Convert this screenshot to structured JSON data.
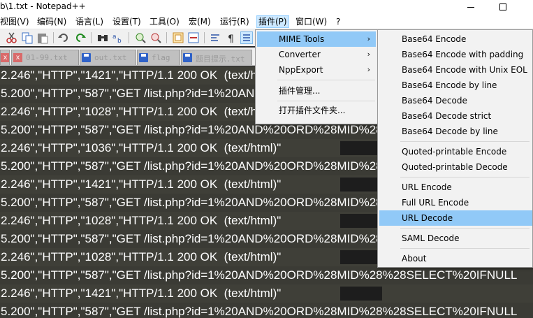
{
  "window": {
    "title": "b\\1.txt - Notepad++"
  },
  "menubar": {
    "items": [
      "视图(V)",
      "编码(N)",
      "语言(L)",
      "设置(T)",
      "工具(O)",
      "宏(M)",
      "运行(R)",
      "插件(P)",
      "窗口(W)",
      "?"
    ],
    "active_index": 7
  },
  "tabs": [
    "01-99.txt",
    "out.txt",
    "flag",
    "题目提示.txt"
  ],
  "editor": {
    "lines": [
      "2.246\",\"HTTP\",\"1421\",\"HTTP/1.1 200 OK  (text/html)\"",
      "5.200\",\"HTTP\",\"587\",\"GET /list.php?id=1%20AND%20ORD%28MID%28%28SELECT%20IFNULL",
      "2.246\",\"HTTP\",\"1028\",\"HTTP/1.1 200 OK  (text/html)\"",
      "5.200\",\"HTTP\",\"587\",\"GET /list.php?id=1%20AND%20ORD%28MID%28%28SELECT%20IFNULL",
      "2.246\",\"HTTP\",\"1036\",\"HTTP/1.1 200 OK  (text/html)\"",
      "5.200\",\"HTTP\",\"587\",\"GET /list.php?id=1%20AND%20ORD%28MID%28%28SELECT%20IFNULL",
      "2.246\",\"HTTP\",\"1421\",\"HTTP/1.1 200 OK  (text/html)\"",
      "5.200\",\"HTTP\",\"587\",\"GET /list.php?id=1%20AND%20ORD%28MID%28%28SELECT%20IFNULL",
      "2.246\",\"HTTP\",\"1028\",\"HTTP/1.1 200 OK  (text/html)\"",
      "5.200\",\"HTTP\",\"587\",\"GET /list.php?id=1%20AND%20ORD%28MID%28%28SELECT%20IFNULL",
      "2.246\",\"HTTP\",\"1028\",\"HTTP/1.1 200 OK  (text/html)\"",
      "5.200\",\"HTTP\",\"587\",\"GET /list.php?id=1%20AND%20ORD%28MID%28%28SELECT%20IFNULL",
      "2.246\",\"HTTP\",\"1421\",\"HTTP/1.1 200 OK  (text/html)\"",
      "5.200\",\"HTTP\",\"587\",\"GET /list.php?id=1%20AND%20ORD%28MID%28%28SELECT%20IFNULL"
    ]
  },
  "plugins_menu": {
    "items": [
      {
        "label": "MIME Tools",
        "submenu": true,
        "highlighted": true
      },
      {
        "label": "Converter",
        "submenu": true
      },
      {
        "label": "NppExport",
        "submenu": true
      },
      {
        "label": "插件管理...",
        "submenu": false
      },
      {
        "label": "打开插件文件夹...",
        "submenu": false
      }
    ]
  },
  "mime_tools_submenu": {
    "items": [
      "Base64 Encode",
      "Base64 Encode with padding",
      "Base64 Encode with Unix EOL",
      "Base64 Encode by line",
      "Base64 Decode",
      "Base64 Decode strict",
      "Base64 Decode by line",
      "Quoted-printable Encode",
      "Quoted-printable Decode",
      "URL Encode",
      "Full URL Encode",
      "URL Decode",
      "SAML Decode",
      "About"
    ],
    "highlighted": "URL Decode"
  },
  "icons": {
    "submenu_arrow": "chevron-right-icon",
    "tab_save": "floppy-icon",
    "tab_close": "close-icon"
  },
  "colors": {
    "editor_bg": "#3b3b35",
    "menu_highlight": "#91c9f7",
    "menubar_active": "#cce8ff"
  }
}
